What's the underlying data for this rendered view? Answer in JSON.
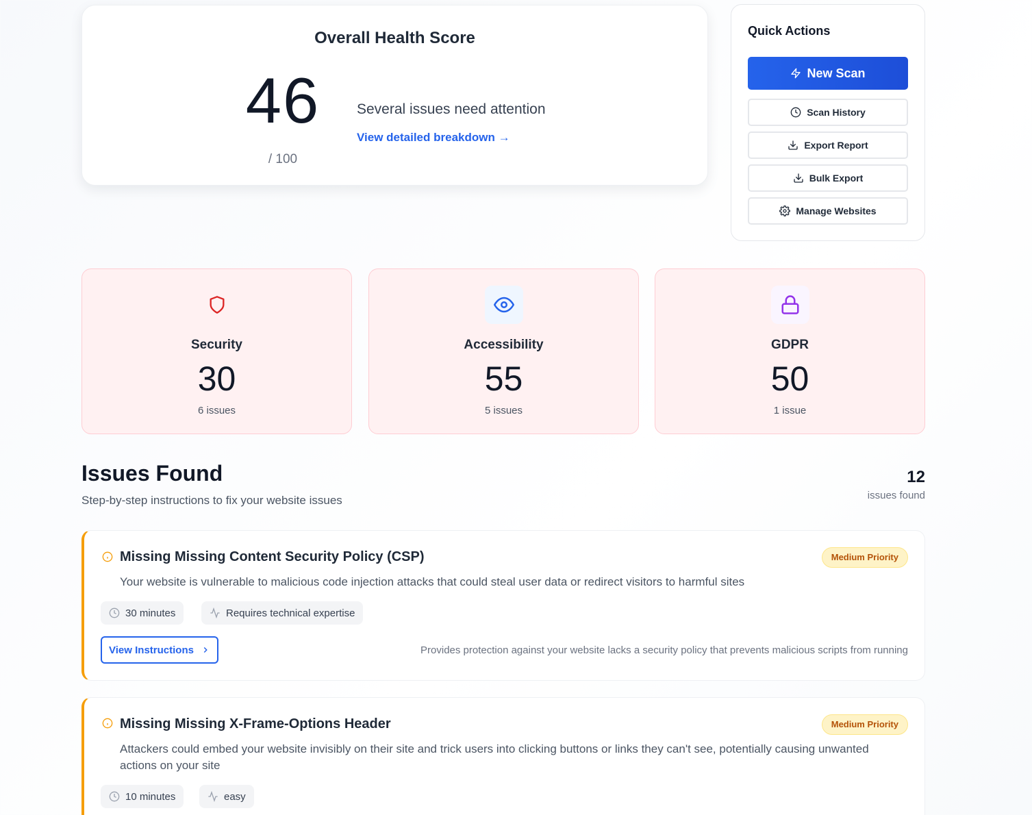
{
  "health": {
    "title": "Overall Health Score",
    "score": "46",
    "out_of": "/ 100",
    "message": "Several issues need attention",
    "link": "View detailed breakdown →"
  },
  "quick_actions": {
    "title": "Quick Actions",
    "new_scan": "New Scan",
    "scan_history": "Scan History",
    "export_report": "Export Report",
    "bulk_export": "Bulk Export",
    "manage_websites": "Manage Websites"
  },
  "categories": [
    {
      "name": "Security",
      "score": "30",
      "issues": "6 issues",
      "icon": "shield-icon",
      "color": "#dc2626"
    },
    {
      "name": "Accessibility",
      "score": "55",
      "issues": "5 issues",
      "icon": "eye-icon",
      "color": "#2563eb"
    },
    {
      "name": "GDPR",
      "score": "50",
      "issues": "1 issue",
      "icon": "lock-icon",
      "color": "#9333ea"
    }
  ],
  "issues_header": {
    "title": "Issues Found",
    "subtitle": "Step-by-step instructions to fix your website issues",
    "count": "12",
    "count_label": "issues found"
  },
  "issues": [
    {
      "title": "Missing Missing Content Security Policy (CSP)",
      "priority": "Medium Priority",
      "description": "Your website is vulnerable to malicious code injection attacks that could steal user data or redirect visitors to harmful sites",
      "time": "30 minutes",
      "difficulty": "Requires technical expertise",
      "button": "View Instructions",
      "note": "Provides protection against your website lacks a security policy that prevents malicious scripts from running"
    },
    {
      "title": "Missing Missing X-Frame-Options Header",
      "priority": "Medium Priority",
      "description": "Attackers could embed your website invisibly on their site and trick users into clicking buttons or links they can't see, potentially causing unwanted actions on your site",
      "time": "10 minutes",
      "difficulty": "easy"
    }
  ],
  "colors": {
    "accent": "#2563eb",
    "warning": "#f59e0b",
    "card_bg": "#fff1f2"
  }
}
